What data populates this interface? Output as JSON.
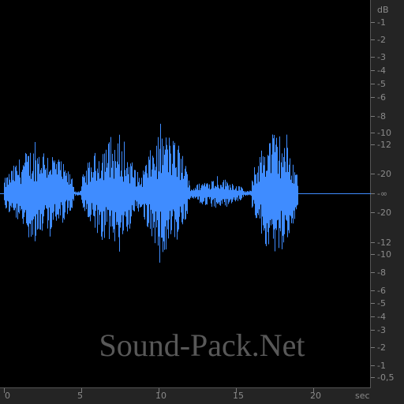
{
  "waveform": {
    "color": "#3f8cff",
    "background": "#000000",
    "duration_sec": 19.0,
    "bursts": [
      {
        "start": 0.0,
        "end": 4.5,
        "amp": 0.55
      },
      {
        "start": 5.0,
        "end": 8.8,
        "amp": 0.62
      },
      {
        "start": 8.8,
        "end": 12.0,
        "amp": 0.7
      },
      {
        "start": 12.0,
        "end": 15.5,
        "amp": 0.18
      },
      {
        "start": 16.0,
        "end": 19.0,
        "amp": 0.72
      }
    ]
  },
  "db_ruler": {
    "unit": "dB",
    "labels": [
      "-1",
      "-2",
      "-3",
      "-4",
      "-5",
      "-6",
      "-8",
      "-10",
      "-12",
      "-20",
      "-∞",
      "-20",
      "-12",
      "-10",
      "-8",
      "-6",
      "-5",
      "-4",
      "-3",
      "-2",
      "-1",
      "-0,5"
    ]
  },
  "time_ruler": {
    "unit": "sec",
    "labels": [
      "0",
      "5",
      "10",
      "15",
      "20"
    ]
  },
  "watermark": "Sound-Pack.Net"
}
